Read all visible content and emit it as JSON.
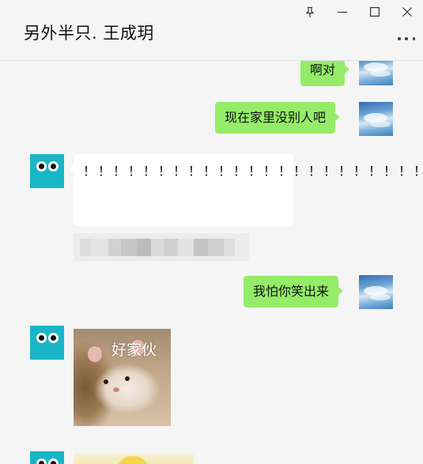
{
  "window": {
    "title": "另外半只. 王成玥",
    "controls": {
      "pin": "pin-icon",
      "minimize": "minimize-icon",
      "maximize": "maximize-icon",
      "close": "close-icon",
      "more": "more-icon"
    }
  },
  "messages": [
    {
      "sender": "self",
      "type": "text",
      "text": "啊对"
    },
    {
      "sender": "self",
      "type": "text",
      "text": "现在家里没别人吧"
    },
    {
      "sender": "other",
      "type": "text",
      "text": "！！！！！！！！！！！！！！！！！！！！！！！！！！！！！！！"
    },
    {
      "sender": "other",
      "type": "blurred"
    },
    {
      "sender": "self",
      "type": "text",
      "text": "我怕你笑出来"
    },
    {
      "sender": "other",
      "type": "sticker",
      "caption": "好家伙"
    },
    {
      "sender": "other",
      "type": "image"
    }
  ],
  "colors": {
    "self_bubble": "#95ec69",
    "other_bubble": "#ffffff",
    "background": "#f5f5f5",
    "avatar_teal": "#1ab5c6"
  }
}
